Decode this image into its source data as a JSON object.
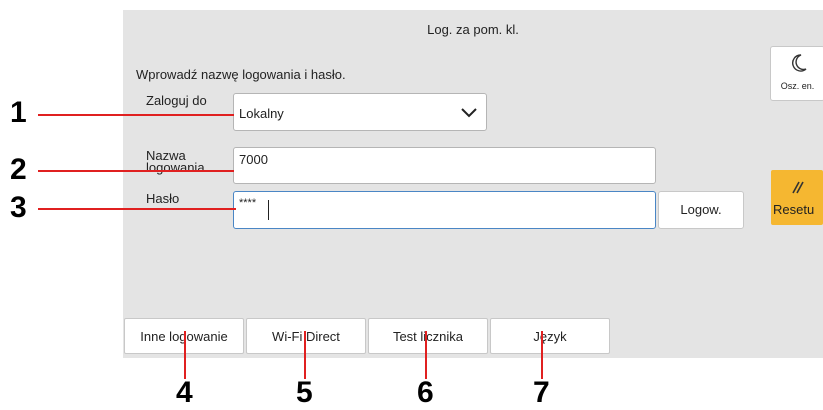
{
  "header": {
    "title": "Log. za pom. kl."
  },
  "form": {
    "instruction": "Wprowadź nazwę logowania i hasło.",
    "login_to_label": "Zaloguj do",
    "login_to_value": "Lokalny",
    "login_name_label_line1": "Nazwa",
    "login_name_label_line2": "logowania",
    "login_name_value": "7000",
    "password_label": "Hasło",
    "password_value": "****",
    "login_button": "Logow."
  },
  "side": {
    "sleep_label": "Osz. en.",
    "reset_label": "Resetu"
  },
  "tabs": [
    {
      "label": "Inne logowanie"
    },
    {
      "label": "Wi-Fi Direct"
    },
    {
      "label": "Test licznika"
    },
    {
      "label": "Język"
    }
  ],
  "callouts": [
    "1",
    "2",
    "3",
    "4",
    "5",
    "6",
    "7"
  ],
  "colors": {
    "callout_line": "#e02020",
    "reset_button": "#f5b731",
    "focus_border": "#4a86c5"
  }
}
